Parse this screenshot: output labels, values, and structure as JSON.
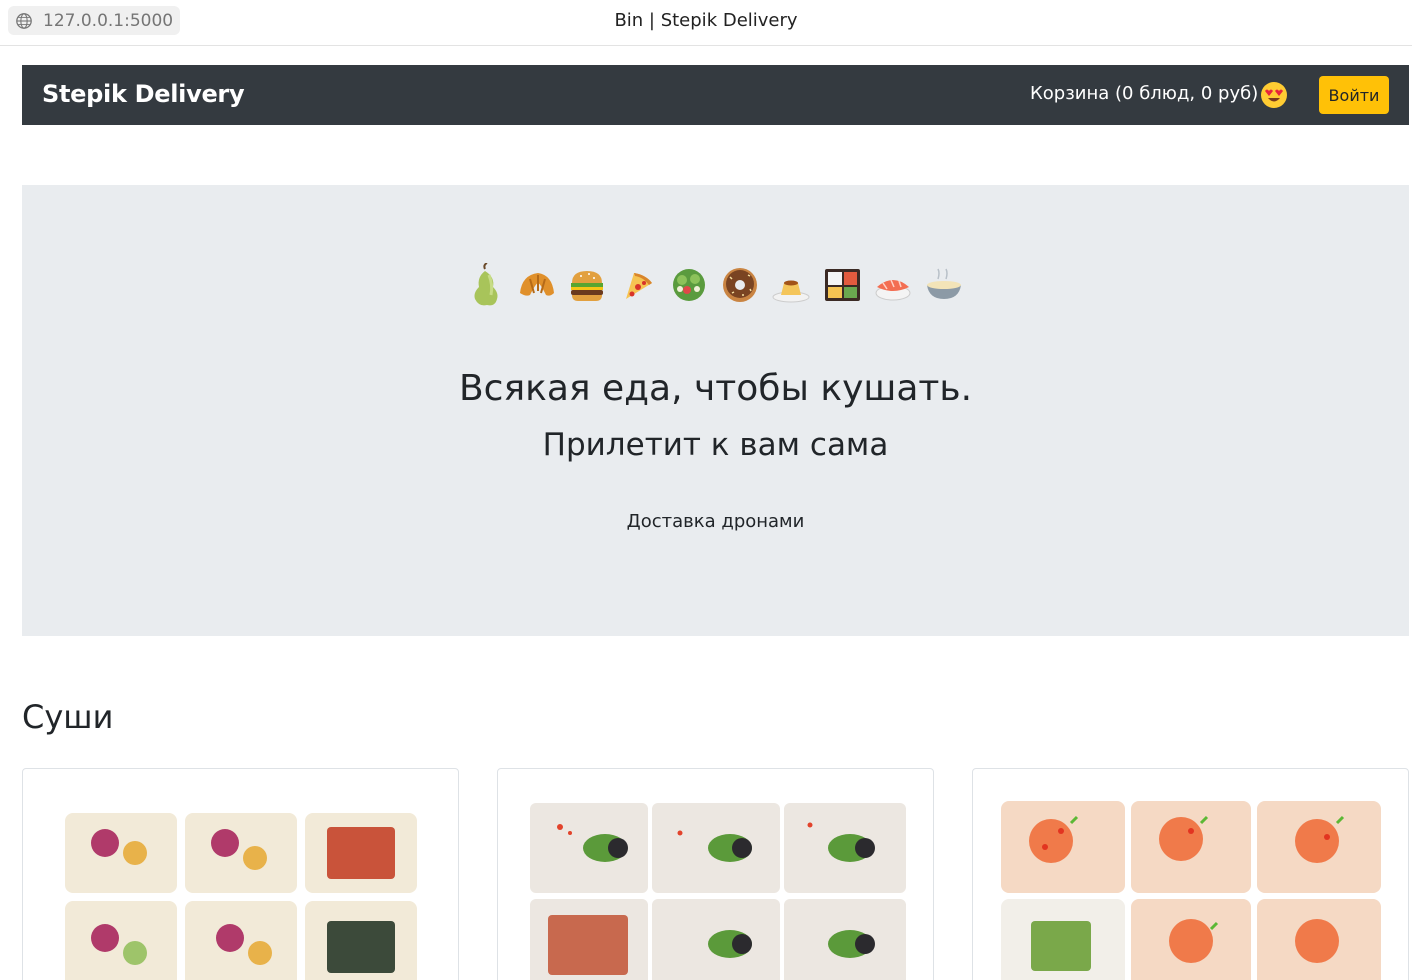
{
  "browser": {
    "url": "127.0.0.1:5000",
    "tab_title": "Bin | Stepik Delivery",
    "globe_icon": "globe-icon"
  },
  "navbar": {
    "brand": "Stepik Delivery",
    "cart_label": "Корзина (0 блюд, 0 руб)",
    "cart_icon": "heart-eyes-emoji-icon",
    "login_label": "Войти",
    "login_color": "#ffc107",
    "background": "#343a40"
  },
  "hero": {
    "icons": [
      "pear-icon",
      "croissant-icon",
      "burger-icon",
      "pizza-icon",
      "salad-icon",
      "donut-icon",
      "flan-icon",
      "bento-icon",
      "sushi-icon",
      "noodle-bowl-icon"
    ],
    "title": "Всякая еда, чтобы кушать.",
    "subtitle": "Прилетит к вам сама",
    "tagline": "Доставка дронами",
    "background": "#e9ecef"
  },
  "section": {
    "title": "Суши",
    "cards": [
      {
        "image": "sushi-roll-image-1"
      },
      {
        "image": "sushi-roll-image-2"
      },
      {
        "image": "sushi-roll-image-3"
      }
    ]
  }
}
